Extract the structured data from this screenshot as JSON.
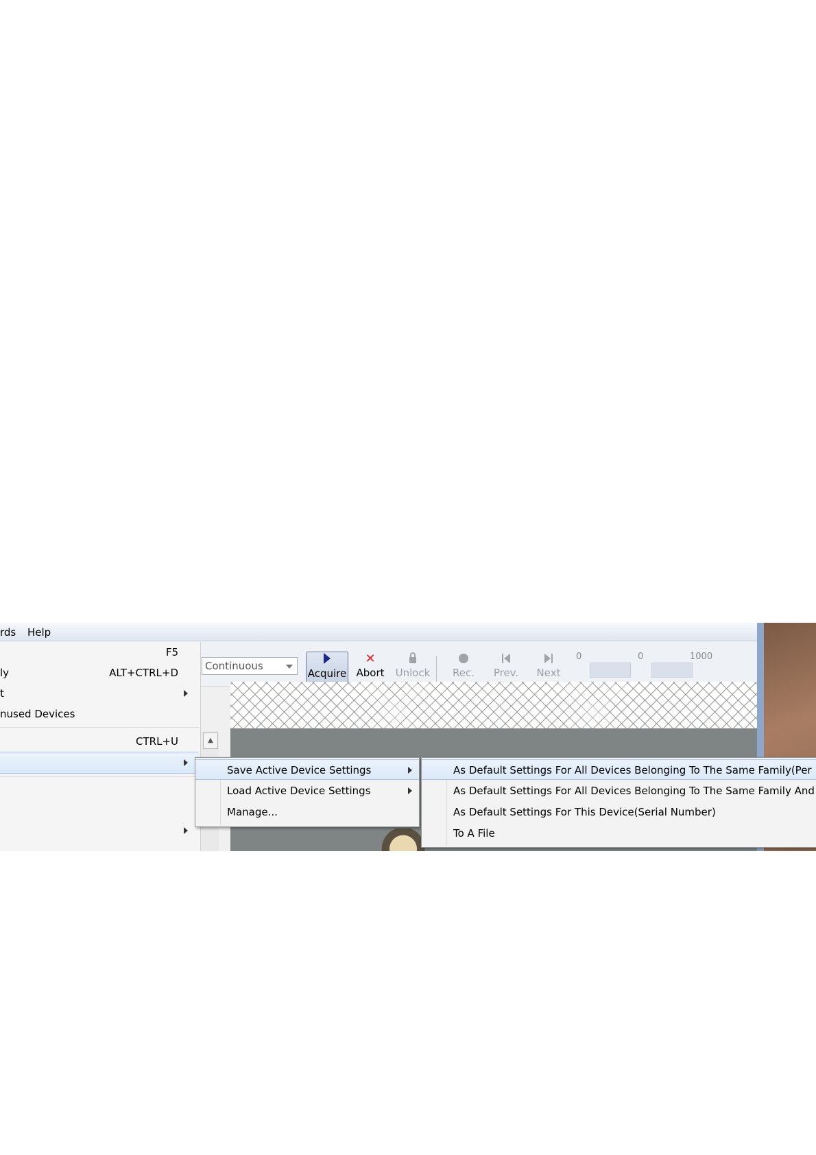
{
  "menubar": {
    "items": [
      "rds",
      "Help"
    ]
  },
  "toolbar": {
    "mode": "Continuous",
    "buttons": [
      {
        "label": "Acquire",
        "icon": "play-icon",
        "state": "pressed"
      },
      {
        "label": "Abort",
        "icon": "x-icon",
        "state": "enabled"
      },
      {
        "label": "Unlock",
        "icon": "lock-icon",
        "state": "disabled"
      },
      {
        "label": "Rec.",
        "icon": "record-icon",
        "state": "disabled"
      },
      {
        "label": "Prev.",
        "icon": "prev-icon",
        "state": "disabled"
      },
      {
        "label": "Next",
        "icon": "next-icon",
        "state": "disabled"
      }
    ],
    "ticks": [
      "0",
      "0",
      "1000"
    ]
  },
  "left_menu": {
    "items": [
      {
        "label": "",
        "shortcut": "F5"
      },
      {
        "label": "ly",
        "shortcut": "ALT+CTRL+D"
      },
      {
        "label": "t",
        "shortcut": ""
      },
      {
        "label": "nused Devices",
        "shortcut": ""
      },
      {
        "label": "",
        "shortcut": "CTRL+U"
      }
    ]
  },
  "submenu1": {
    "items": [
      "Save Active Device Settings",
      "Load Active Device Settings",
      "Manage..."
    ]
  },
  "submenu2": {
    "items": [
      "As Default Settings For All Devices Belonging To The Same Family(Per",
      "As Default Settings For All Devices Belonging To The Same Family And",
      "As Default Settings For This Device(Serial Number)",
      "To A File"
    ]
  },
  "colors": {
    "highlight": "#dce9f8",
    "abort": "#e02020",
    "acquire": "#1a2a8a"
  }
}
